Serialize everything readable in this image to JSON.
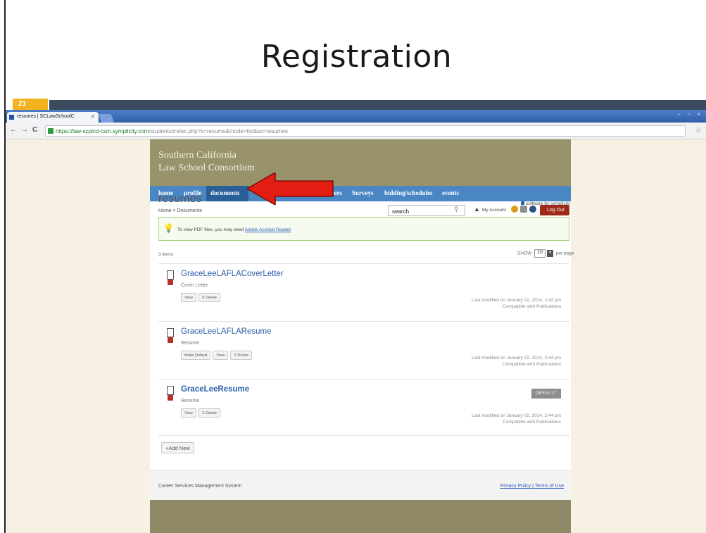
{
  "slide": {
    "title": "Registration",
    "number": "21"
  },
  "browser": {
    "tab_title": "resumes | SCLawSchoolC",
    "tab_close": "×",
    "url_host": "https://law-scpicd-csm.symplicity.com",
    "url_path": "/students/index.php?s=resume&mode=list&ss=resumes",
    "window_controls": "– ▫ ×"
  },
  "site": {
    "banner_line1": "Southern California",
    "banner_line2": "Law School Consortium",
    "nav": [
      "home",
      "profile",
      "documents",
      "",
      "",
      "",
      "loyers",
      "Surveys",
      "bidding/schedules",
      "events"
    ]
  },
  "toolbar": {
    "breadcrumb": "Home > Documents",
    "search_value": "search",
    "my_account": "My Account",
    "logout": "Log Out"
  },
  "page": {
    "title": "resumes",
    "vendor": "software by symplicity"
  },
  "notice": {
    "text": "To view PDF files, you may need",
    "link": "Adobe Acrobat Reader"
  },
  "list": {
    "count": "3 items",
    "show_label": "SHOW",
    "show_value": "10",
    "per_page": "per page",
    "items": [
      {
        "name": "GraceLeeLAFLACoverLetter",
        "type": "Cover Letter",
        "buttons": [
          "View",
          "X Delete"
        ],
        "modified": "Last modified on January 02, 2014, 2:42 pm",
        "compat": "Compatible with Publications",
        "badge": ""
      },
      {
        "name": "GraceLeeLAFLAResume",
        "type": "Resume",
        "buttons": [
          "Make Default",
          "View",
          "X Delete"
        ],
        "modified": "Last modified on January 02, 2014, 2:44 pm",
        "compat": "Compatible with Publications",
        "badge": ""
      },
      {
        "name": "GraceLeeResume",
        "type": "Resume",
        "buttons": [
          "View",
          "X Delete"
        ],
        "modified": "Last modified on January 02, 2014, 2:44 pm",
        "compat": "Compatible with Publications",
        "badge": "DEFAULT"
      }
    ],
    "add_new": "+Add New"
  },
  "footer": {
    "left": "Career Services Management System",
    "privacy": "Privacy Policy",
    "separator": "|",
    "terms": "Terms of Use"
  },
  "colors": {
    "banner": "#99936b",
    "nav": "#4a86c4",
    "logout": "#a02a1a",
    "link": "#2a62b8",
    "arrow": "#e41d12"
  }
}
